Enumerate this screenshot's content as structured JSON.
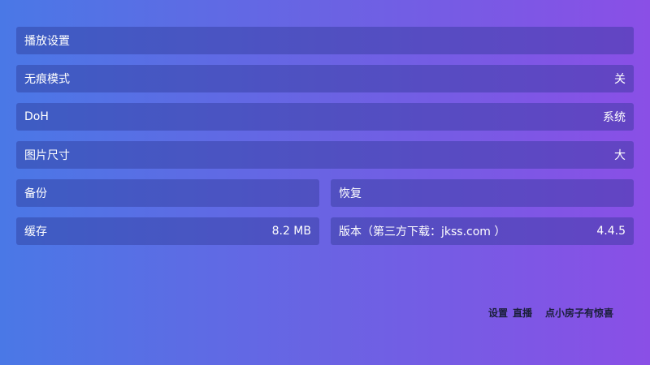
{
  "settings": {
    "playback": {
      "label": "播放设置"
    },
    "incognito": {
      "label": "无痕模式",
      "value": "关"
    },
    "doh": {
      "label": "DoH",
      "value": "系统"
    },
    "image_size": {
      "label": "图片尺寸",
      "value": "大"
    },
    "backup": {
      "label": "备份"
    },
    "restore": {
      "label": "恢复"
    },
    "cache": {
      "label": "缓存",
      "value": "8.2 MB"
    },
    "version": {
      "label": "版本（第三方下载：jkss.com ）",
      "value": "4.4.5"
    }
  },
  "footer": {
    "settings_link": "设置",
    "live_link": "直播",
    "hint": "点小房子有惊喜"
  },
  "colors": {
    "gradient_start": "#4a78e6",
    "gradient_end": "#8a4fe6",
    "footer_text": "#1a1f3a"
  }
}
